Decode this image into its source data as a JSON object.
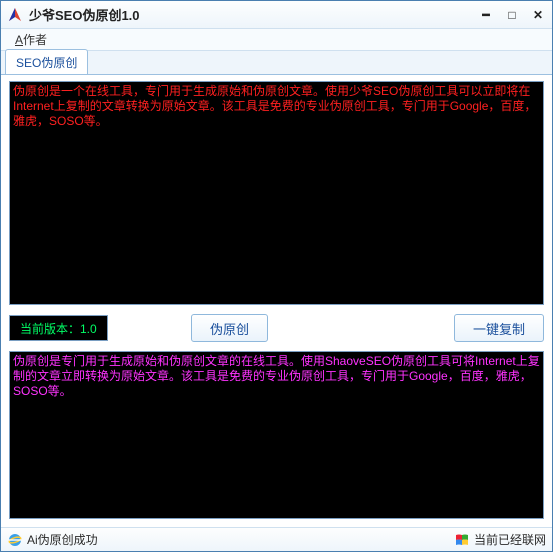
{
  "window": {
    "title": "少爷SEO伪原创1.0"
  },
  "menu": {
    "author": "作者",
    "author_accel": "A"
  },
  "tabs": {
    "main": "SEO伪原创"
  },
  "input_text": "伪原创是一个在线工具，专门用于生成原始和伪原创文章。使用少爷SEO伪原创工具可以立即将在Internet上复制的文章转换为原始文章。该工具是免费的专业伪原创工具，专门用于Google，百度，雅虎，SOSO等。",
  "version": {
    "label": "当前版本：1.0"
  },
  "buttons": {
    "pseudo": "伪原创",
    "copy": "一键复制"
  },
  "output_text": "伪原创是专门用于生成原始和伪原创文章的在线工具。使用ShaoveSEO伪原创工具可将Internet上复制的文章立即转换为原始文章。该工具是免费的专业伪原创工具，专门用于Google，百度，雅虎，SOSO等。",
  "status": {
    "left": "Ai伪原创成功",
    "right": "当前已经联网"
  }
}
